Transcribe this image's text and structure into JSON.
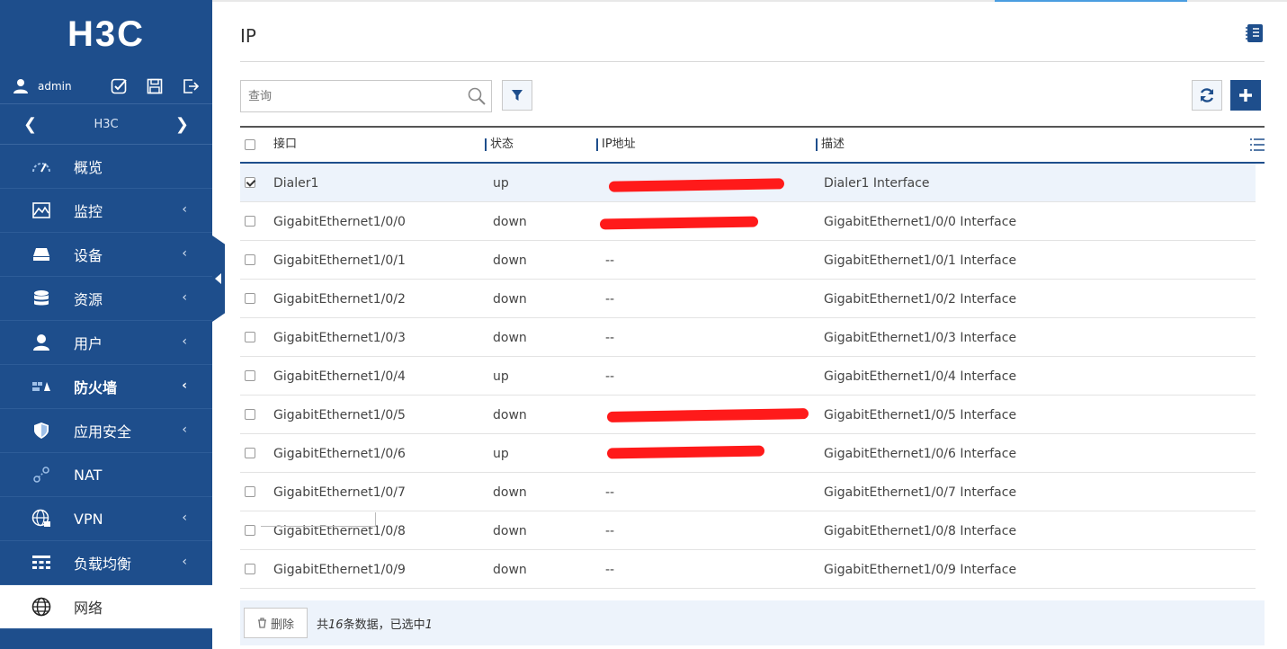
{
  "sidebar": {
    "logo": "H3C",
    "user": "admin",
    "device_name": "H3C",
    "items": [
      {
        "label": "概览",
        "icon": "gauge-icon",
        "has_arrow": false
      },
      {
        "label": "监控",
        "icon": "monitor-chart-icon",
        "has_arrow": true
      },
      {
        "label": "设备",
        "icon": "device-icon",
        "has_arrow": true
      },
      {
        "label": "资源",
        "icon": "database-icon",
        "has_arrow": true
      },
      {
        "label": "用户",
        "icon": "user-icon",
        "has_arrow": true
      },
      {
        "label": "防火墙",
        "icon": "firewall-icon",
        "has_arrow": true
      },
      {
        "label": "应用安全",
        "icon": "shield-icon",
        "has_arrow": true
      },
      {
        "label": "NAT",
        "icon": "nat-link-icon",
        "has_arrow": false
      },
      {
        "label": "VPN",
        "icon": "globe-lock-icon",
        "has_arrow": true
      },
      {
        "label": "负载均衡",
        "icon": "load-balance-icon",
        "has_arrow": true
      },
      {
        "label": "网络",
        "icon": "globe-icon",
        "has_arrow": false
      }
    ]
  },
  "page": {
    "title": "IP",
    "search_placeholder": "查询"
  },
  "table": {
    "headers": [
      "接口",
      "状态",
      "IP地址",
      "描述"
    ],
    "rows": [
      {
        "iface": "Dialer1",
        "status": "up",
        "ip": "",
        "desc": "Dialer1 Interface",
        "checked": true
      },
      {
        "iface": "GigabitEthernet1/0/0",
        "status": "down",
        "ip": "",
        "desc": "GigabitEthernet1/0/0 Interface",
        "checked": false
      },
      {
        "iface": "GigabitEthernet1/0/1",
        "status": "down",
        "ip": "--",
        "desc": "GigabitEthernet1/0/1 Interface",
        "checked": false
      },
      {
        "iface": "GigabitEthernet1/0/2",
        "status": "down",
        "ip": "--",
        "desc": "GigabitEthernet1/0/2 Interface",
        "checked": false
      },
      {
        "iface": "GigabitEthernet1/0/3",
        "status": "down",
        "ip": "--",
        "desc": "GigabitEthernet1/0/3 Interface",
        "checked": false
      },
      {
        "iface": "GigabitEthernet1/0/4",
        "status": "up",
        "ip": "--",
        "desc": "GigabitEthernet1/0/4 Interface",
        "checked": false
      },
      {
        "iface": "GigabitEthernet1/0/5",
        "status": "down",
        "ip": "",
        "desc": "GigabitEthernet1/0/5 Interface",
        "checked": false
      },
      {
        "iface": "GigabitEthernet1/0/6",
        "status": "up",
        "ip": "",
        "desc": "GigabitEthernet1/0/6 Interface",
        "checked": false
      },
      {
        "iface": "GigabitEthernet1/0/7",
        "status": "down",
        "ip": "--",
        "desc": "GigabitEthernet1/0/7 Interface",
        "checked": false
      },
      {
        "iface": "GigabitEthernet1/0/8",
        "status": "down",
        "ip": "--",
        "desc": "GigabitEthernet1/0/8 Interface",
        "checked": false
      },
      {
        "iface": "GigabitEthernet1/0/9",
        "status": "down",
        "ip": "--",
        "desc": "GigabitEthernet1/0/9 Interface",
        "checked": false
      }
    ]
  },
  "footer": {
    "delete_label": "删除",
    "summary_prefix": "共",
    "total": "16",
    "summary_mid": "条数据，已选中",
    "selected": "1"
  },
  "colors": {
    "brand": "#1e4e8c",
    "redaction": "#ff1a1a",
    "selected_row": "#edf3fb"
  }
}
